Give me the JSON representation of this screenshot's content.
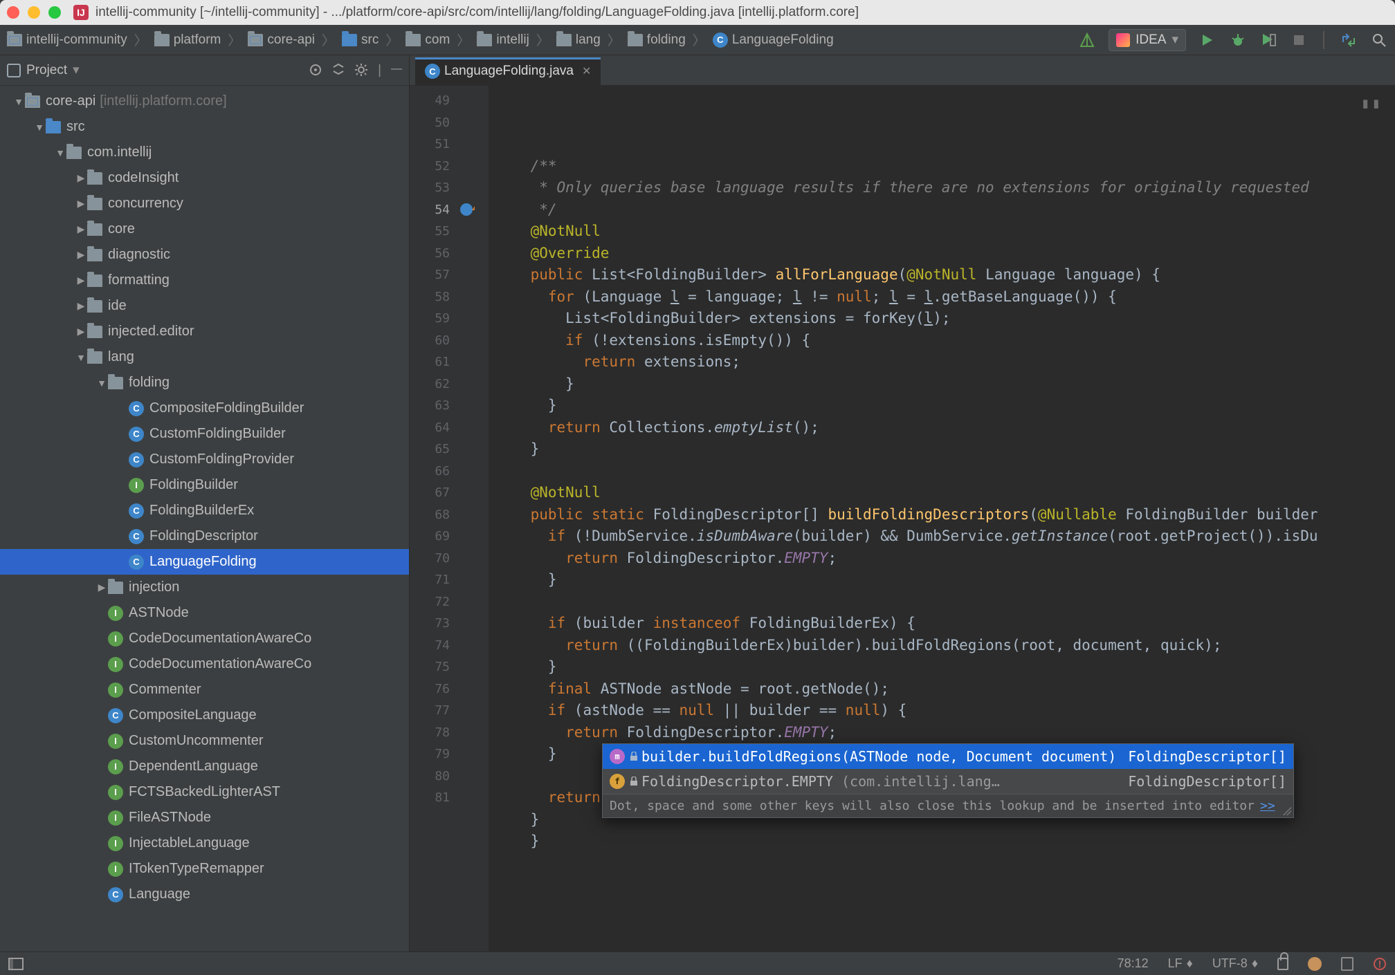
{
  "window": {
    "title": "intellij-community [~/intellij-community] - .../platform/core-api/src/com/intellij/lang/folding/LanguageFolding.java [intellij.platform.core]"
  },
  "breadcrumbs": [
    {
      "icon": "module",
      "label": "intellij-community"
    },
    {
      "icon": "folder",
      "label": "platform"
    },
    {
      "icon": "module",
      "label": "core-api"
    },
    {
      "icon": "folder-blue",
      "label": "src"
    },
    {
      "icon": "folder",
      "label": "com"
    },
    {
      "icon": "folder",
      "label": "intellij"
    },
    {
      "icon": "folder",
      "label": "lang"
    },
    {
      "icon": "folder",
      "label": "folding"
    },
    {
      "icon": "class-c",
      "label": "LanguageFolding"
    }
  ],
  "run_config": "IDEA",
  "sidebar": {
    "title": "Project",
    "nodes": [
      {
        "depth": 0,
        "twisty": "down",
        "icon": "module",
        "label": "core-api",
        "hint": "[intellij.platform.core]"
      },
      {
        "depth": 1,
        "twisty": "down",
        "icon": "folder-blue",
        "label": "src"
      },
      {
        "depth": 2,
        "twisty": "down",
        "icon": "folder",
        "label": "com.intellij"
      },
      {
        "depth": 3,
        "twisty": "right",
        "icon": "folder",
        "label": "codeInsight"
      },
      {
        "depth": 3,
        "twisty": "right",
        "icon": "folder",
        "label": "concurrency"
      },
      {
        "depth": 3,
        "twisty": "right",
        "icon": "folder",
        "label": "core"
      },
      {
        "depth": 3,
        "twisty": "right",
        "icon": "folder",
        "label": "diagnostic"
      },
      {
        "depth": 3,
        "twisty": "right",
        "icon": "folder",
        "label": "formatting"
      },
      {
        "depth": 3,
        "twisty": "right",
        "icon": "folder",
        "label": "ide"
      },
      {
        "depth": 3,
        "twisty": "right",
        "icon": "folder",
        "label": "injected.editor"
      },
      {
        "depth": 3,
        "twisty": "down",
        "icon": "folder",
        "label": "lang"
      },
      {
        "depth": 4,
        "twisty": "down",
        "icon": "folder",
        "label": "folding"
      },
      {
        "depth": 5,
        "twisty": "",
        "icon": "class-c",
        "label": "CompositeFoldingBuilder"
      },
      {
        "depth": 5,
        "twisty": "",
        "icon": "class-ca",
        "label": "CustomFoldingBuilder"
      },
      {
        "depth": 5,
        "twisty": "",
        "icon": "class-ca",
        "label": "CustomFoldingProvider"
      },
      {
        "depth": 5,
        "twisty": "",
        "icon": "class-i",
        "label": "FoldingBuilder"
      },
      {
        "depth": 5,
        "twisty": "",
        "icon": "class-ca",
        "label": "FoldingBuilderEx"
      },
      {
        "depth": 5,
        "twisty": "",
        "icon": "class-c",
        "label": "FoldingDescriptor"
      },
      {
        "depth": 5,
        "twisty": "",
        "icon": "class-c",
        "label": "LanguageFolding",
        "selected": true
      },
      {
        "depth": 4,
        "twisty": "right",
        "icon": "folder",
        "label": "injection"
      },
      {
        "depth": 4,
        "twisty": "",
        "icon": "class-i",
        "label": "ASTNode"
      },
      {
        "depth": 4,
        "twisty": "",
        "icon": "class-i",
        "label": "CodeDocumentationAwareCo"
      },
      {
        "depth": 4,
        "twisty": "",
        "icon": "class-i",
        "label": "CodeDocumentationAwareCo"
      },
      {
        "depth": 4,
        "twisty": "",
        "icon": "class-i",
        "label": "Commenter"
      },
      {
        "depth": 4,
        "twisty": "",
        "icon": "class-c",
        "label": "CompositeLanguage"
      },
      {
        "depth": 4,
        "twisty": "",
        "icon": "class-i",
        "label": "CustomUncommenter"
      },
      {
        "depth": 4,
        "twisty": "",
        "icon": "class-i",
        "label": "DependentLanguage"
      },
      {
        "depth": 4,
        "twisty": "",
        "icon": "class-i",
        "label": "FCTSBackedLighterAST"
      },
      {
        "depth": 4,
        "twisty": "",
        "icon": "class-i",
        "label": "FileASTNode"
      },
      {
        "depth": 4,
        "twisty": "",
        "icon": "class-i",
        "label": "InjectableLanguage"
      },
      {
        "depth": 4,
        "twisty": "",
        "icon": "class-i",
        "label": "ITokenTypeRemapper"
      },
      {
        "depth": 4,
        "twisty": "",
        "icon": "class-ca",
        "label": "Language"
      }
    ]
  },
  "editor": {
    "tab_label": "LanguageFolding.java",
    "first_line": 49,
    "current_visual_line": 5,
    "lines": [
      {
        "html": "<span class='comment'>/**</span>"
      },
      {
        "html": "<span class='comment'> * Only queries base language results if there are no extensions for originally requested</span>"
      },
      {
        "html": "<span class='comment'> */</span>"
      },
      {
        "html": "<span class='ann'>@NotNull</span>"
      },
      {
        "html": "<span class='ann'>@Override</span>"
      },
      {
        "html": "<span class='kw'>public</span> List&lt;FoldingBuilder&gt; <span class='method'>allForLanguage</span>(<span class='ann'>@NotNull</span> Language <span class='param'>language</span>) {",
        "marker": "override"
      },
      {
        "html": "  <span class='kw'>for</span> (Language <u>l</u> = <span class='param'>language</span>; <u>l</u> != <span class='kw'>null</span>; <u>l</u> = <u>l</u>.getBaseLanguage()) {"
      },
      {
        "html": "    List&lt;FoldingBuilder&gt; <span class='param'>extensions</span> = forKey(<u>l</u>);"
      },
      {
        "html": "    <span class='kw'>if</span> (!<span class='param'>extensions</span>.isEmpty()) {"
      },
      {
        "html": "      <span class='kw'>return</span> <span class='param'>extensions</span>;"
      },
      {
        "html": "    }"
      },
      {
        "html": "  }"
      },
      {
        "html": "  <span class='kw'>return</span> Collections.<span class='static'>emptyList</span>();"
      },
      {
        "html": "}"
      },
      {
        "html": ""
      },
      {
        "html": "<span class='ann'>@NotNull</span>"
      },
      {
        "html": "<span class='kw'>public</span> <span class='kw'>static</span> FoldingDescriptor[] <span class='method'>buildFoldingDescriptors</span>(<span class='ann'>@Nullable</span> FoldingBuilder <span class='param'>builder</span>"
      },
      {
        "html": "  <span class='kw'>if</span> (!DumbService.<span class='static'>isDumbAware</span>(<span class='param'>builder</span>) && DumbService.<span class='static'>getInstance</span>(<span class='param'>root</span>.getProject()).isDu"
      },
      {
        "html": "    <span class='kw'>return</span> FoldingDescriptor.<span class='field'>EMPTY</span>;"
      },
      {
        "html": "  }"
      },
      {
        "html": ""
      },
      {
        "html": "  <span class='kw'>if</span> (<span class='param'>builder</span> <span class='kw'>instanceof</span> FoldingBuilderEx) {"
      },
      {
        "html": "    <span class='kw'>return</span> ((FoldingBuilderEx)<span class='param'>builder</span>).buildFoldRegions(<span class='param'>root</span>, <span class='param'>document</span>, <span class='param'>quick</span>);"
      },
      {
        "html": "  }"
      },
      {
        "html": "  <span class='kw'>final</span> ASTNode <span class='param'>astNode</span> = <span class='param'>root</span>.getNode();"
      },
      {
        "html": "  <span class='kw'>if</span> (<span class='param'>astNode</span> == <span class='kw'>null</span> || <span class='param'>builder</span> == <span class='kw'>null</span>) {"
      },
      {
        "html": "    <span class='kw'>return</span> FoldingDescriptor.<span class='field'>EMPTY</span>;"
      },
      {
        "html": "  }"
      },
      {
        "html": ""
      },
      {
        "html": "  <span class='kw'>return</span> <span class='caret'></span>"
      },
      {
        "html": "}"
      },
      {
        "html": "}"
      },
      {
        "html": ""
      }
    ],
    "base_indent": "    "
  },
  "completion": {
    "items": [
      {
        "icon": "m",
        "text": "builder.buildFoldRegions(ASTNode node, Document document)",
        "type": "FoldingDescriptor[]",
        "selected": true
      },
      {
        "icon": "f",
        "text": "FoldingDescriptor.EMPTY",
        "tail": "(com.intellij.lang…",
        "type": "FoldingDescriptor[]"
      }
    ],
    "hint": "Dot, space and some other keys will also close this lookup and be inserted into editor",
    "more": ">>"
  },
  "status": {
    "pos": "78:12",
    "sep": "LF",
    "enc": "UTF-8"
  }
}
